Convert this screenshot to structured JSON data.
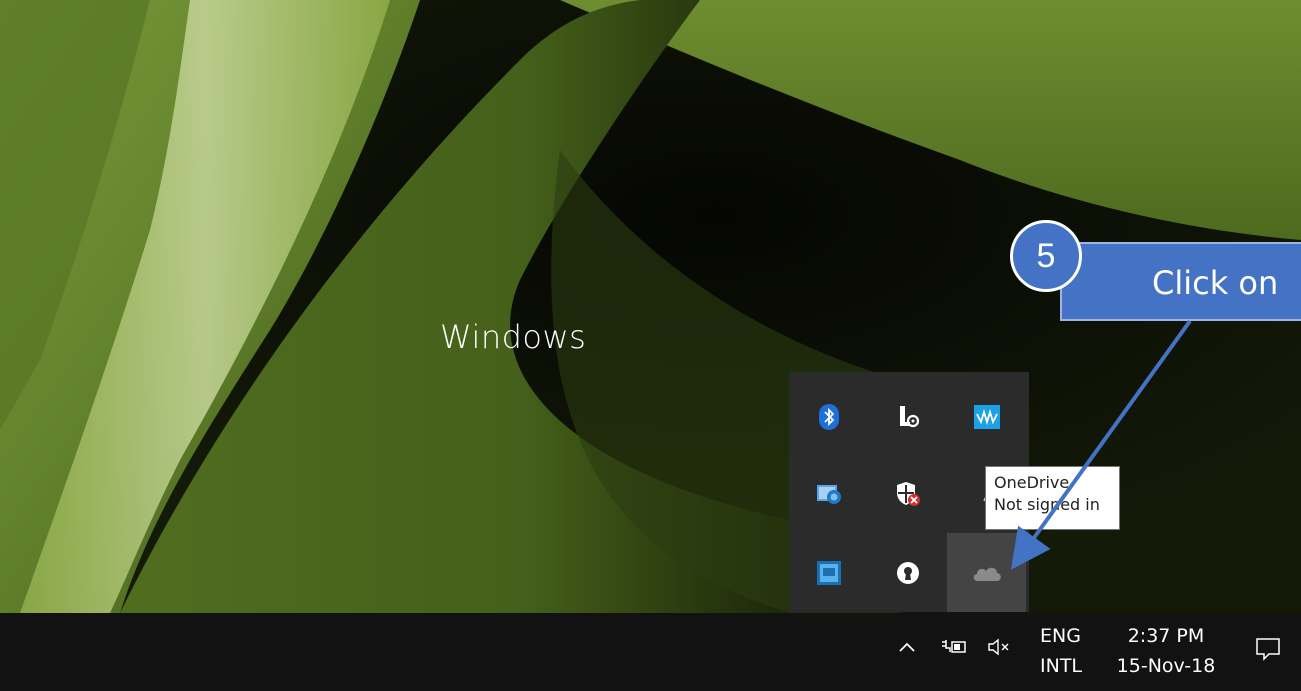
{
  "desktop": {
    "watermark_text": "Windows"
  },
  "callout": {
    "step_number": "5",
    "instruction": "Click on",
    "color": "#4472c4"
  },
  "tray_overflow": {
    "icons": [
      {
        "name": "bluetooth-icon"
      },
      {
        "name": "settings-person-icon"
      },
      {
        "name": "audio-wave-icon"
      },
      {
        "name": "network-globe-icon"
      },
      {
        "name": "security-shield-icon"
      },
      {
        "name": "hidden-icon"
      },
      {
        "name": "intel-graphics-icon"
      },
      {
        "name": "keyhole-icon"
      },
      {
        "name": "onedrive-cloud-icon"
      }
    ]
  },
  "tooltip": {
    "line1": "OneDrive",
    "line2": "Not signed in"
  },
  "taskbar": {
    "language_line1": "ENG",
    "language_line2": "INTL",
    "time": "2:37 PM",
    "date": "15-Nov-18"
  }
}
